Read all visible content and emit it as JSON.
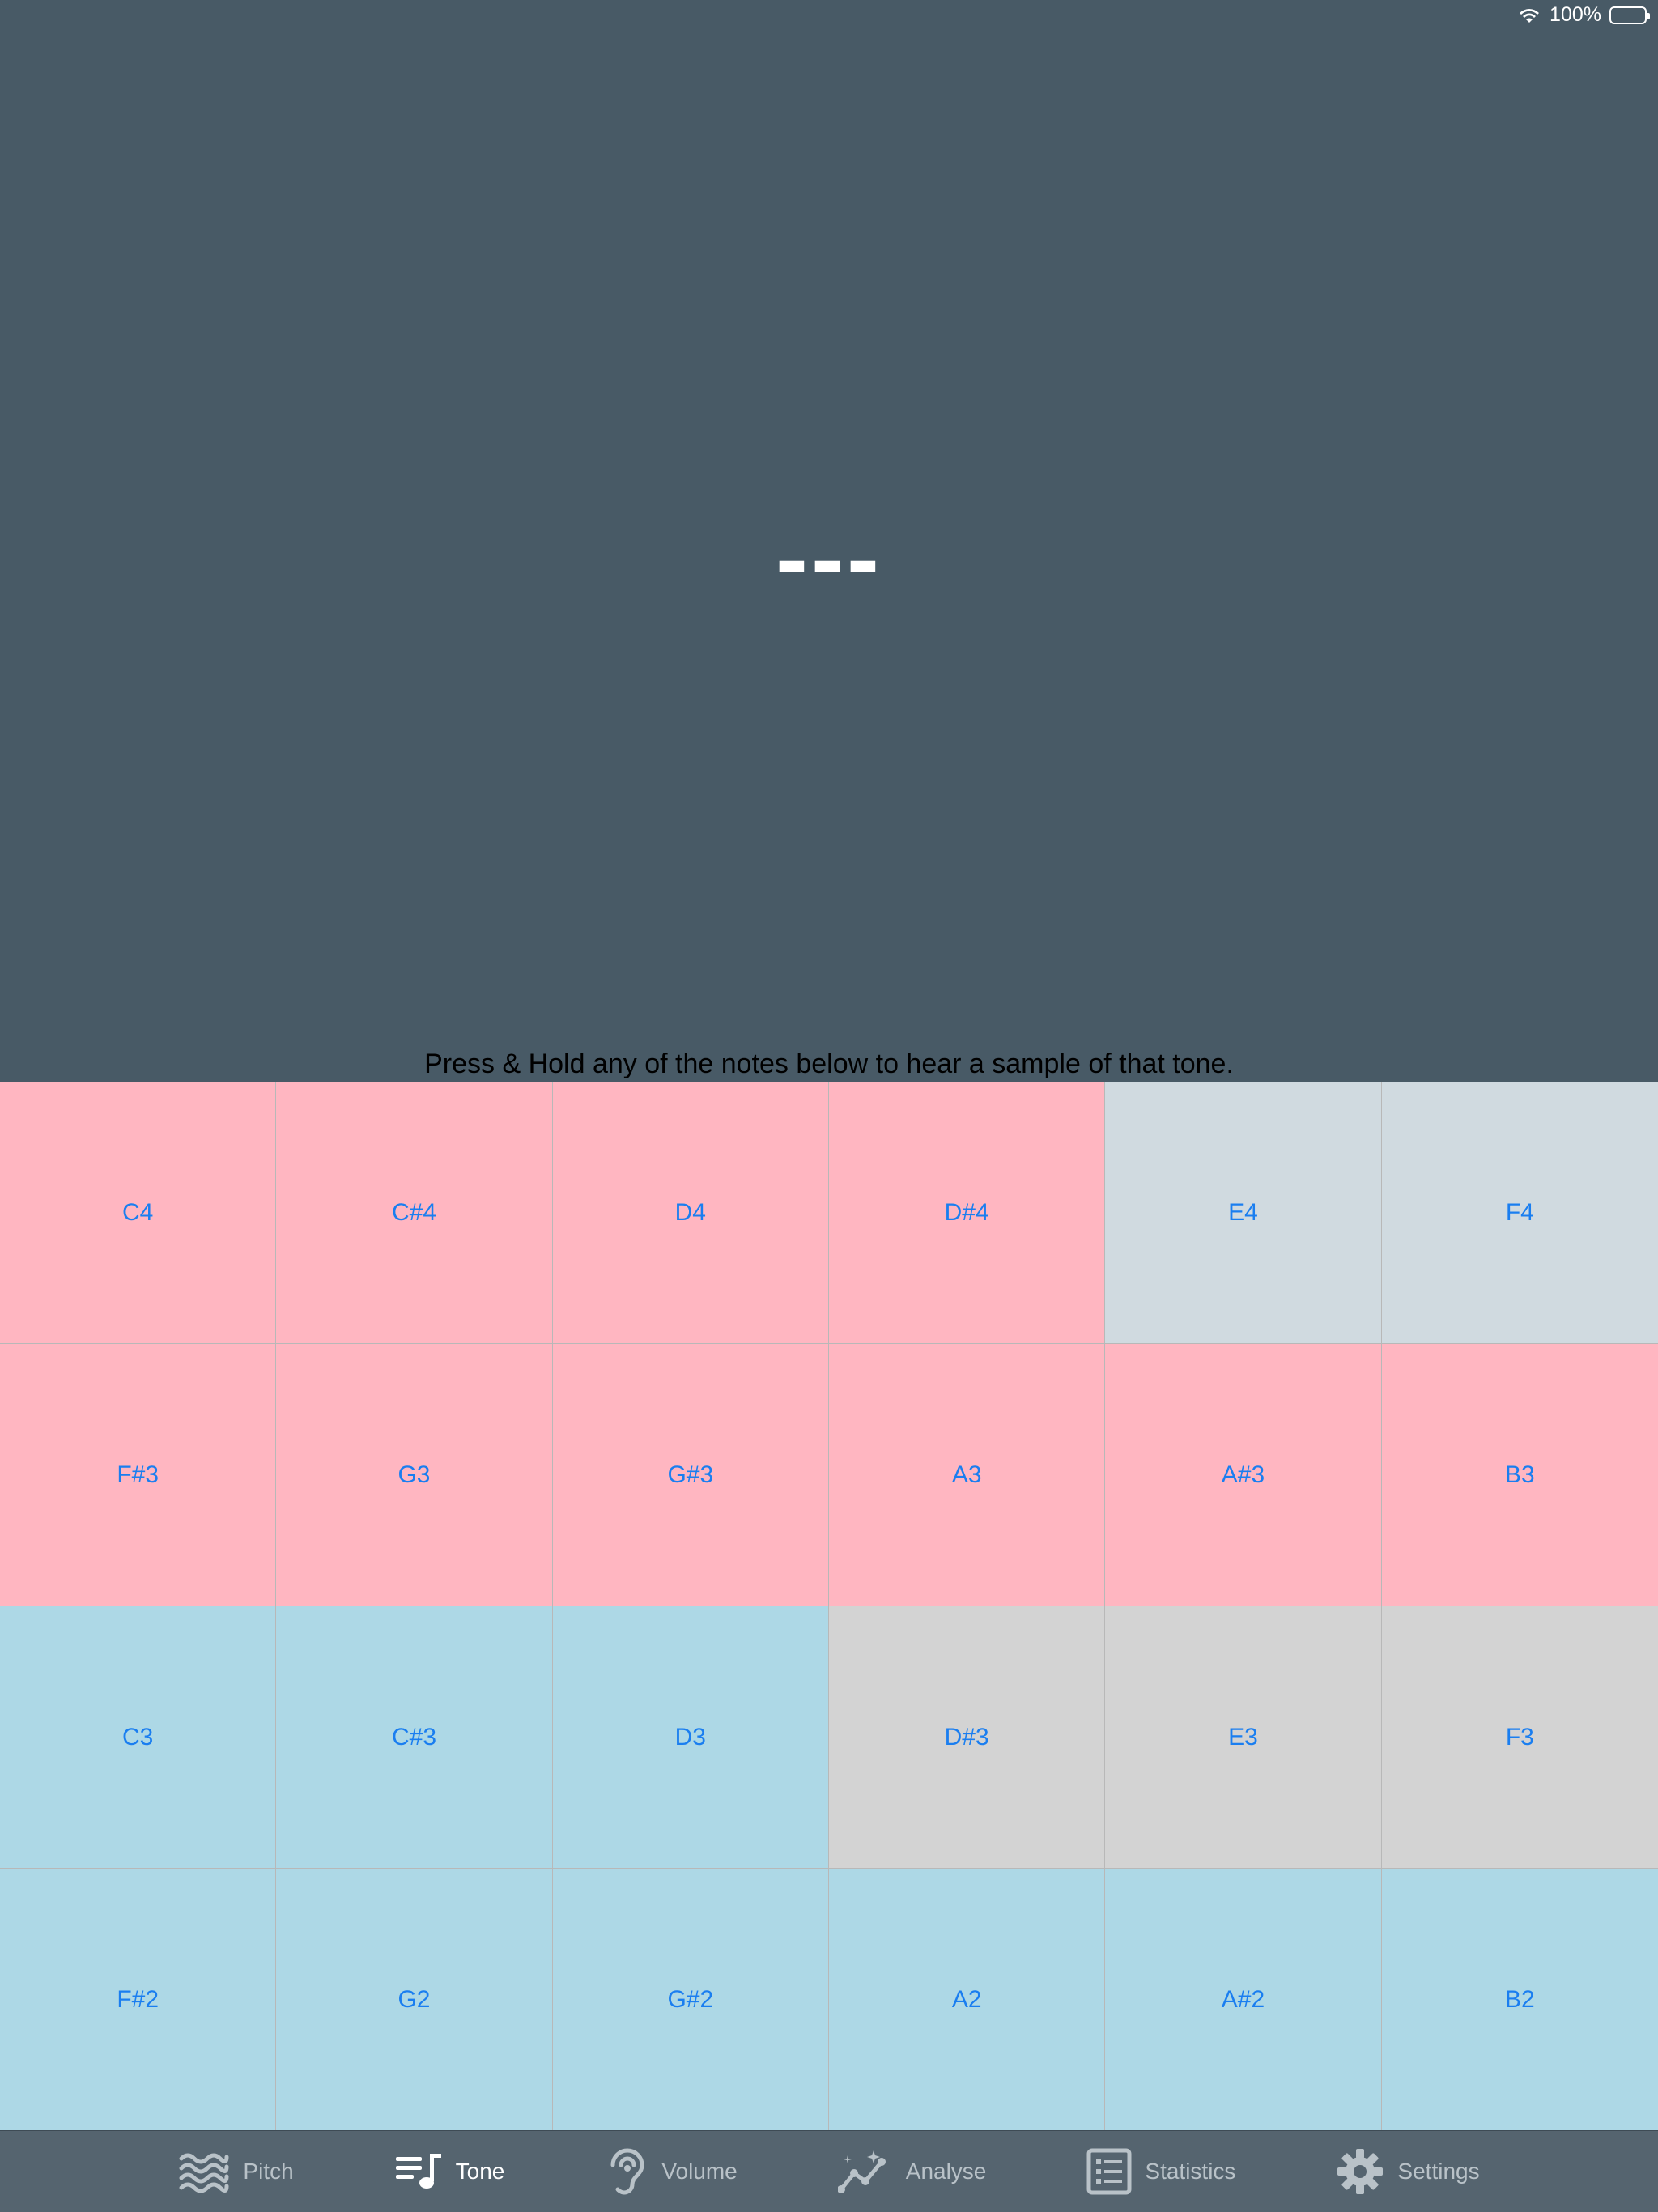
{
  "status_bar": {
    "battery_text": "100%",
    "wifi_icon": "wifi-icon",
    "battery_icon": "battery-icon"
  },
  "display": {
    "tone": "---"
  },
  "instruction": "Press & Hold any of the notes below to hear a sample of that tone.",
  "colors": {
    "background": "#485a66",
    "note_label": "#1a7ef0",
    "pink": "#ffb6c1",
    "slate": "#d0dae0",
    "blue": "#add8e6",
    "gray": "#d3d3d3",
    "tab_bar": "#55646f",
    "tab_inactive": "#b9c2c8",
    "tab_active": "#ffffff"
  },
  "notes": [
    {
      "label": "C4",
      "color": "pink"
    },
    {
      "label": "C#4",
      "color": "pink"
    },
    {
      "label": "D4",
      "color": "pink"
    },
    {
      "label": "D#4",
      "color": "pink"
    },
    {
      "label": "E4",
      "color": "slate"
    },
    {
      "label": "F4",
      "color": "slate"
    },
    {
      "label": "F#3",
      "color": "pink"
    },
    {
      "label": "G3",
      "color": "pink"
    },
    {
      "label": "G#3",
      "color": "pink"
    },
    {
      "label": "A3",
      "color": "pink"
    },
    {
      "label": "A#3",
      "color": "pink"
    },
    {
      "label": "B3",
      "color": "pink"
    },
    {
      "label": "C3",
      "color": "blue"
    },
    {
      "label": "C#3",
      "color": "blue"
    },
    {
      "label": "D3",
      "color": "blue"
    },
    {
      "label": "D#3",
      "color": "gray"
    },
    {
      "label": "E3",
      "color": "gray"
    },
    {
      "label": "F3",
      "color": "gray"
    },
    {
      "label": "F#2",
      "color": "blue"
    },
    {
      "label": "G2",
      "color": "blue"
    },
    {
      "label": "G#2",
      "color": "blue"
    },
    {
      "label": "A2",
      "color": "blue"
    },
    {
      "label": "A#2",
      "color": "blue"
    },
    {
      "label": "B2",
      "color": "blue"
    }
  ],
  "tabs": [
    {
      "label": "Pitch",
      "icon": "waves-icon",
      "active": false
    },
    {
      "label": "Tone",
      "icon": "music-queue-icon",
      "active": true
    },
    {
      "label": "Volume",
      "icon": "ear-icon",
      "active": false
    },
    {
      "label": "Analyse",
      "icon": "sparkle-chart-icon",
      "active": false
    },
    {
      "label": "Statistics",
      "icon": "list-icon",
      "active": false
    },
    {
      "label": "Settings",
      "icon": "gear-icon",
      "active": false
    }
  ]
}
